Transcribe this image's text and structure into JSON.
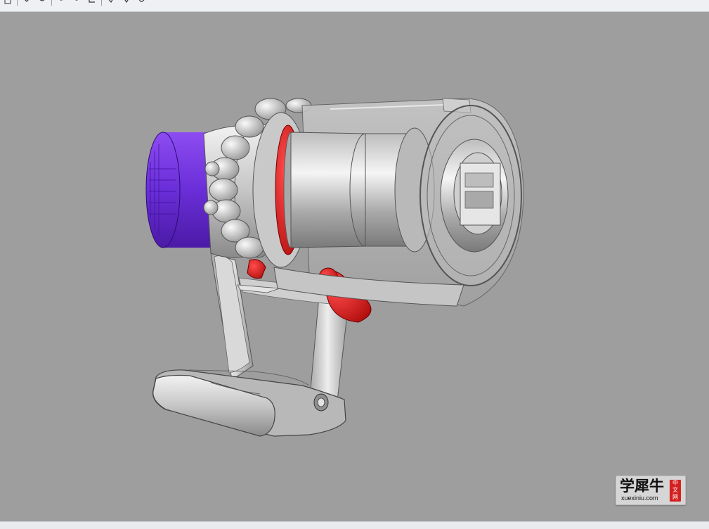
{
  "toolbar": {
    "icons": [
      "view-cube-icon",
      "orbit-icon",
      "rotate-icon",
      "zoom-icon",
      "pan-icon",
      "fit-icon",
      "measure-icon",
      "select-icon",
      "section-icon"
    ]
  },
  "viewport": {
    "background": "#9e9e9e",
    "model": "handheld cordless vacuum cyclone assembly",
    "colors": {
      "body": "#d4d4d4",
      "filter": "#6b2ed6",
      "accent": "#e01c1c",
      "bin": "#c8c8c8"
    }
  },
  "watermark": {
    "main": "学犀牛",
    "sub": "xuexiniu.com",
    "seal": [
      "中",
      "文",
      "网"
    ],
    "seal_color": "#d51f1f"
  }
}
